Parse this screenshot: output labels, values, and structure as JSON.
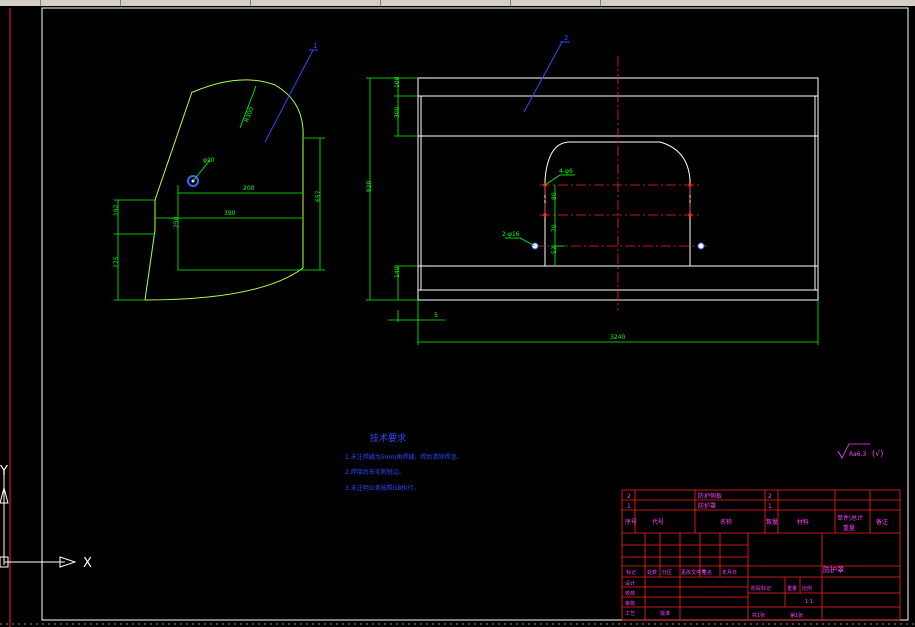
{
  "part_a": {
    "leader_label": "1",
    "dims": {
      "radius_r300": "R300",
      "hole_phi20": "φ20",
      "d200": "200",
      "d390": "390",
      "d250": "250",
      "d657": "657",
      "d192": "192",
      "d275": "275"
    }
  },
  "part_b": {
    "leader_label": "2",
    "dims": {
      "left_100": "100",
      "left_300": "300",
      "left_920": "920",
      "left_140": "140",
      "bottom_50": "5",
      "bottom_width": "3240",
      "note_4phi6": "4-φ6",
      "note_2phi16": "2-φ16",
      "inner_80": "80",
      "inner_70": "70",
      "inner_52": "52"
    }
  },
  "tech_requirements": {
    "title": "技术要求",
    "lines": [
      "1.未注焊缝为5mm角焊缝，焊后清除焊渣。",
      "2.焊接后去毛刺锐边。",
      "3.未注明公差按照GB执行。"
    ]
  },
  "surface_finish": {
    "symbol_text": "Ra6.3",
    "suffix": "(√)"
  },
  "title_block": {
    "parts_list": [
      {
        "no": "2",
        "name": "防护侧板"
      },
      {
        "no": "1",
        "name": "防护罩"
      }
    ],
    "header": {
      "seq": "序号",
      "code": "代号",
      "name": "名称",
      "qty": "数量",
      "material": "材料",
      "unit_total": "单件|总计",
      "weight": "重量",
      "remark": "备注"
    },
    "drawing_name": "防护罩",
    "scale": "1:1",
    "sheet_total": "共1张",
    "sheet_no": "第1张",
    "rows": [
      "设计",
      "校核",
      "审核",
      "工艺",
      "批准"
    ],
    "labels": [
      "标记",
      "处数",
      "分区",
      "更改文件号",
      "签名",
      "年月日",
      "阶段标记",
      "重量",
      "比例"
    ]
  },
  "ucs": {
    "x_label": "X",
    "y_label": "Y"
  },
  "colors": {
    "geometry": "#ffffff",
    "dimension": "#00ff00",
    "centerline": "#ff2020",
    "annotation": "#2a48ff",
    "title_block": "#ff2020",
    "note_text": "#ff3cff"
  }
}
